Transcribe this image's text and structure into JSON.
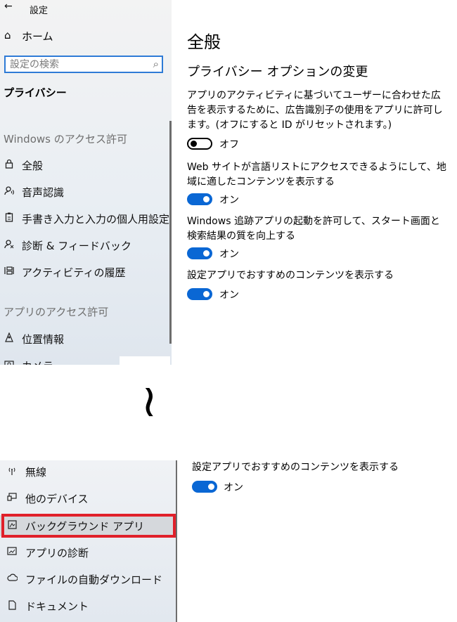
{
  "window": {
    "back_glyph": "←",
    "title": "設定"
  },
  "sidebar": {
    "home_label": "ホーム",
    "search_placeholder": "設定の検索",
    "section_title": "プライバシー",
    "groups": [
      {
        "heading": "Windows のアクセス許可",
        "items": [
          {
            "label": "全般",
            "icon": "lock-icon"
          },
          {
            "label": "音声認識",
            "icon": "speech-icon"
          },
          {
            "label": "手書き入力と入力の個人用設定",
            "icon": "clipboard-icon"
          },
          {
            "label": "診断 & フィードバック",
            "icon": "feedback-icon"
          },
          {
            "label": "アクティビティの履歴",
            "icon": "timeline-icon"
          }
        ]
      },
      {
        "heading": "アプリのアクセス許可",
        "items": [
          {
            "label": "位置情報",
            "icon": "location-icon"
          },
          {
            "label": "カメラ",
            "icon": "camera-icon"
          }
        ]
      }
    ]
  },
  "main": {
    "title": "全般",
    "subtitle": "プライバシー オプションの変更",
    "settings": [
      {
        "description": "アプリのアクティビティに基づいてユーザーに合わせた広告を表示するために、広告識別子の使用をアプリに許可します。(オフにすると ID がリセットされます。)",
        "state": "オフ",
        "on": false
      },
      {
        "description": "Web サイトが言語リストにアクセスできるようにして、地域に適したコンテンツを表示する",
        "state": "オン",
        "on": true
      },
      {
        "description": "Windows 追跡アプリの起動を許可して、スタート画面と検索結果の質を向上する",
        "state": "オン",
        "on": true
      },
      {
        "description": "設定アプリでおすすめのコンテンツを表示する",
        "state": "オン",
        "on": true
      }
    ]
  },
  "separator": "~",
  "bottom": {
    "sidebar_items": [
      {
        "label": "無線",
        "icon": "antenna-icon",
        "selected": false
      },
      {
        "label": "他のデバイス",
        "icon": "devices-icon",
        "selected": false
      },
      {
        "label": "バックグラウンド アプリ",
        "icon": "background-apps-icon",
        "selected": true
      },
      {
        "label": "アプリの診断",
        "icon": "app-diagnostics-icon",
        "selected": false
      },
      {
        "label": "ファイルの自動ダウンロード",
        "icon": "cloud-icon",
        "selected": false
      },
      {
        "label": "ドキュメント",
        "icon": "document-icon",
        "selected": false
      }
    ],
    "setting": {
      "description": "設定アプリでおすすめのコンテンツを表示する",
      "state": "オン",
      "on": true
    }
  },
  "colors": {
    "accent": "#0a67d4",
    "highlight": "#e0202a",
    "search_border": "#2e7bd6"
  }
}
